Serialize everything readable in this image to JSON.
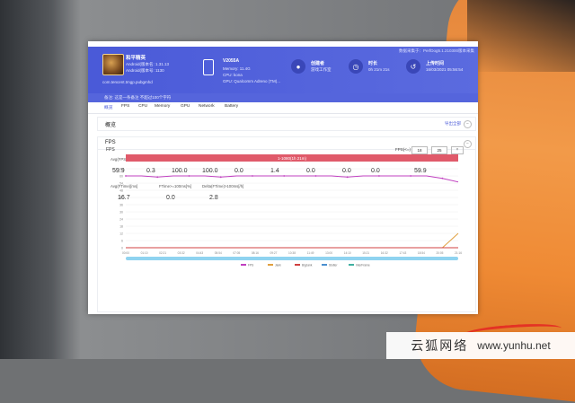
{
  "header": {
    "top_note": "数据采集于：PerfDog5.1.210300版本采集",
    "game": {
      "name": "和平精英",
      "android_version": "Android(版本名: 1.31.13",
      "android_code": "Android(版本号: 1130",
      "package": "com.tencent.tmgp.pubgmhd"
    },
    "note": "备注: 这是一条备注 不超过100个字符",
    "device": {
      "title": "V2055A",
      "line1": "Memory: 11.4G",
      "line2": "CPU: kona",
      "line3": "GPU: Qualcomm Adreno (TM)..."
    },
    "upload": {
      "title": "创建者",
      "sub": "游戏工作室",
      "icon": "user-icon"
    },
    "duration": {
      "title": "时长",
      "sub": "0h 21m 21s",
      "icon": "clock-icon"
    },
    "time": {
      "title": "上传时间",
      "sub": "16/03/2021 05:56:54",
      "icon": "history-icon"
    }
  },
  "tabs": [
    "概览",
    "FPS",
    "CPU",
    "Memory",
    "GPU",
    "Network",
    "Battery"
  ],
  "overview": {
    "title": "概览",
    "link": "导出全部"
  },
  "fps_section": {
    "title": "FPS",
    "metrics_row1": [
      {
        "label": "Avg(FPS)",
        "value": "59.9"
      },
      {
        "label": "Var(FPS)",
        "value": "0.3"
      },
      {
        "label": "FPS>=18[%]",
        "value": "100.0"
      },
      {
        "label": "FPS>=25[%]",
        "value": "100.0"
      },
      {
        "label": "Drop(FPS)[/h]",
        "value": "0.0"
      },
      {
        "label": "Jank(/10min)",
        "value": "1.4"
      },
      {
        "label": "BigJank(/10min)",
        "value": "0.0"
      },
      {
        "label": "Stutter[%]",
        "value": "0.0"
      },
      {
        "label": "Avg(InterFrame)",
        "value": "0.0"
      },
      {
        "label": "Avg(FPS+InterFrame)",
        "value": "59.9"
      }
    ],
    "metrics_row2": [
      {
        "label": "Avg(FTime)[ms]",
        "value": "16.7"
      },
      {
        "label": "FTime>=100ms[%]",
        "value": "0.0"
      },
      {
        "label": "Delta(FTime)>100ms[/h]",
        "value": "2.8"
      }
    ]
  },
  "chart_data": {
    "type": "line",
    "title": "FPS",
    "range_label": "FPS(<=)",
    "inputs": [
      "18",
      "25"
    ],
    "range_bar": "1-1080(1h 21m)",
    "ylim": [
      0,
      66
    ],
    "yticks": [
      "66",
      "60",
      "54",
      "48",
      "42",
      "36",
      "30",
      "24",
      "18",
      "12",
      "6",
      "0"
    ],
    "xticks": [
      "00:00",
      "01:10",
      "02:21",
      "03:32",
      "04:43",
      "05:54",
      "07:05",
      "08:16",
      "09:27",
      "10:38",
      "11:49",
      "13:00",
      "14:10",
      "15:21",
      "16:32",
      "17:43",
      "18:54",
      "20:05",
      "21:16"
    ],
    "series": [
      {
        "name": "FPS",
        "color": "#c040c0",
        "values": [
          60,
          60,
          59,
          60,
          60,
          60,
          59,
          60,
          60,
          60,
          60,
          60,
          60,
          60,
          59,
          60,
          60,
          60,
          60,
          60,
          58,
          55
        ]
      },
      {
        "name": "Jank",
        "color": "#e0a040",
        "values": [
          0,
          0,
          0,
          0,
          0,
          0,
          0,
          0,
          0,
          0,
          0,
          0,
          0,
          0,
          0,
          0,
          0,
          0,
          0,
          0,
          0,
          12
        ]
      },
      {
        "name": "BigJank",
        "color": "#d04040",
        "values": [
          0,
          0,
          0,
          0,
          0,
          0,
          0,
          0,
          0,
          0,
          0,
          0,
          0,
          0,
          0,
          0,
          0,
          0,
          0,
          0,
          0,
          0
        ]
      }
    ],
    "legend": [
      "FPS",
      "Jank",
      "BigJank",
      "Stutter",
      "InterFrame"
    ]
  },
  "watermark": {
    "text": "云狐网络",
    "url": "www.yunhu.net"
  },
  "colors": {
    "header": "#4a5ad8",
    "accent": "#4a5ad8",
    "range_bar": "#e05a6a"
  }
}
